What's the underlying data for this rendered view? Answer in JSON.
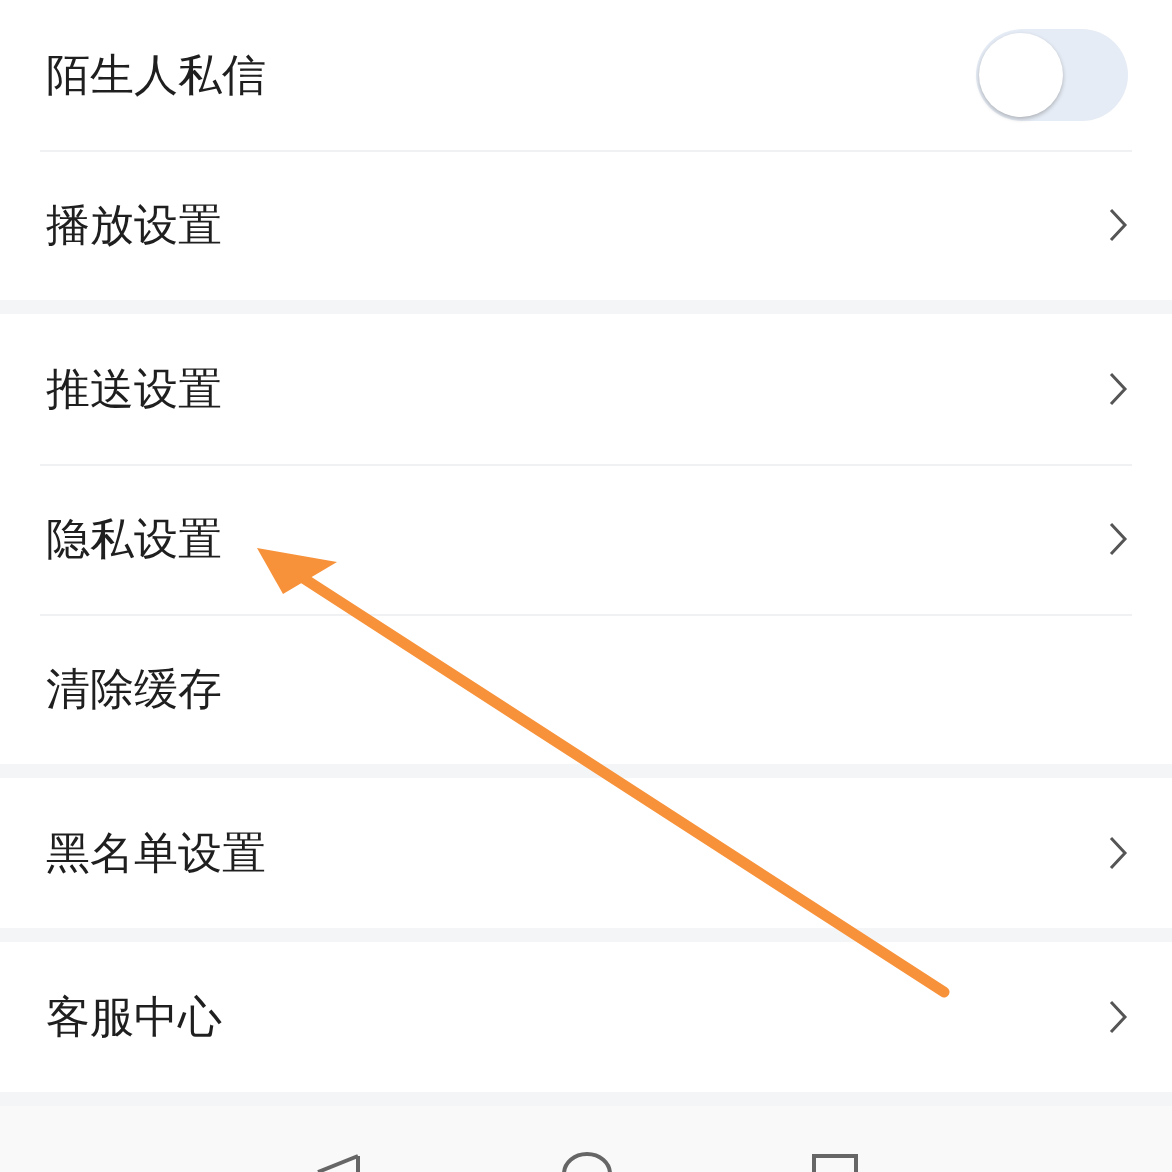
{
  "groups": [
    {
      "items": [
        {
          "label": "陌生人私信",
          "kind": "toggle",
          "on": false
        },
        {
          "label": "播放设置",
          "kind": "link"
        }
      ]
    },
    {
      "items": [
        {
          "label": "推送设置",
          "kind": "link"
        },
        {
          "label": "隐私设置",
          "kind": "link"
        },
        {
          "label": "清除缓存",
          "kind": "plain"
        }
      ]
    },
    {
      "items": [
        {
          "label": "黑名单设置",
          "kind": "link"
        }
      ]
    },
    {
      "items": [
        {
          "label": "客服中心",
          "kind": "link"
        }
      ]
    }
  ]
}
